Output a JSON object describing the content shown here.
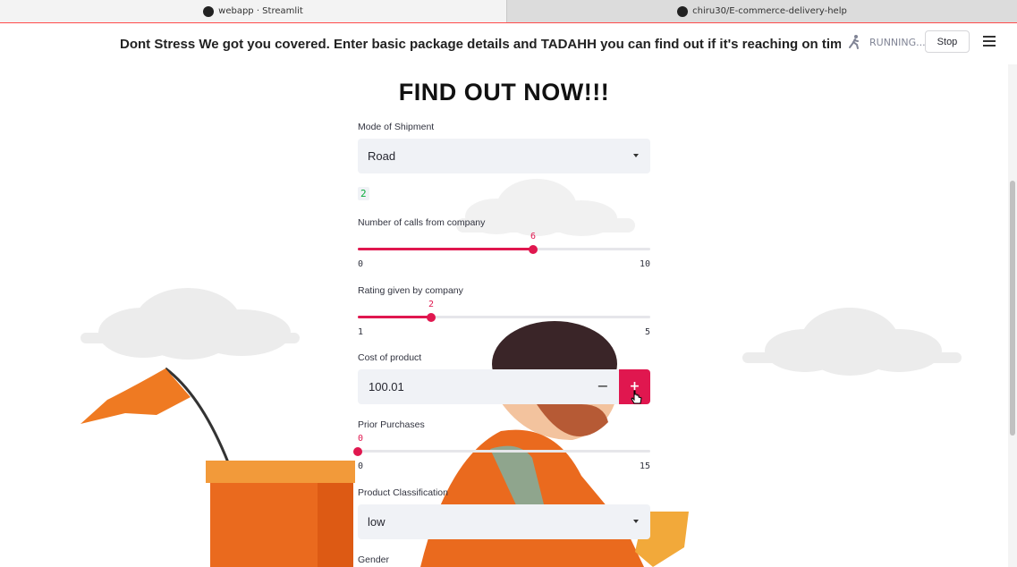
{
  "browser": {
    "tabs": [
      {
        "label": "webapp · Streamlit"
      },
      {
        "label": "chiru30/E-commerce-delivery-help"
      }
    ]
  },
  "header": {
    "marquee_text": "Dont Stress We got you covered. Enter basic package details and TADAHH you can find out if it's reaching on time",
    "status_text": "RUNNING...",
    "stop_label": "Stop"
  },
  "page": {
    "title": "FIND OUT NOW!!!"
  },
  "form": {
    "mode_of_shipment": {
      "label": "Mode of Shipment",
      "value": "Road"
    },
    "selected_index_display": "2",
    "calls": {
      "label": "Number of calls from company",
      "value": 6,
      "value_text": "6",
      "min": 0,
      "max": 10,
      "min_text": "0",
      "max_text": "10"
    },
    "rating": {
      "label": "Rating given by company",
      "value": 2,
      "value_text": "2",
      "min": 1,
      "max": 5,
      "min_text": "1",
      "max_text": "5"
    },
    "cost": {
      "label": "Cost of product",
      "value": "100.01",
      "minus": "−",
      "plus": "+"
    },
    "prior_purchases": {
      "label": "Prior Purchases",
      "value": 0,
      "value_text": "0",
      "min": 0,
      "max": 15,
      "min_text": "0",
      "max_text": "15"
    },
    "product_classification": {
      "label": "Product Classification",
      "value": "low"
    },
    "gender": {
      "label": "Gender"
    }
  },
  "colors": {
    "accent": "#e0174f",
    "success": "#09ab3b",
    "input_bg": "#f0f2f6"
  }
}
